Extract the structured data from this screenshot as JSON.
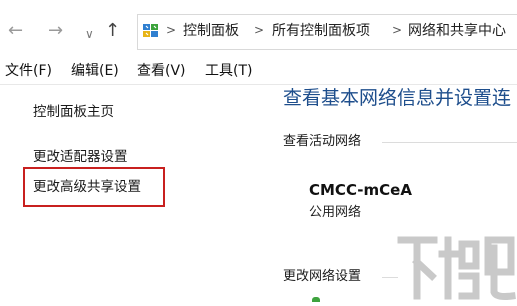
{
  "address_bar": {
    "back_icon": "back-arrow-icon",
    "forward_icon": "forward-arrow-icon",
    "recent_icon": "chevron-down-icon",
    "up_icon": "up-arrow-icon",
    "location_icon": "control-panel-icon",
    "breadcrumbs": [
      "控制面板",
      "所有控制面板项",
      "网络和共享中心"
    ],
    "separator": ">"
  },
  "menu": {
    "items": [
      "文件(F)",
      "编辑(E)",
      "查看(V)",
      "工具(T)"
    ]
  },
  "left_pane": {
    "home_link": "控制面板主页",
    "adapter_link": "更改适配器设置",
    "advanced_sharing_link": "更改高级共享设置",
    "highlight_color": "#c8201f"
  },
  "main": {
    "title": "查看基本网络信息并设置连",
    "active_networks_heading": "查看活动网络",
    "network_name": "CMCC-mCeA",
    "network_type": "公用网络",
    "change_settings_heading": "更改网络设置",
    "title_color": "#1e4e8c"
  },
  "watermark": {
    "text": "下载吧",
    "icon": "download-site-logo"
  }
}
